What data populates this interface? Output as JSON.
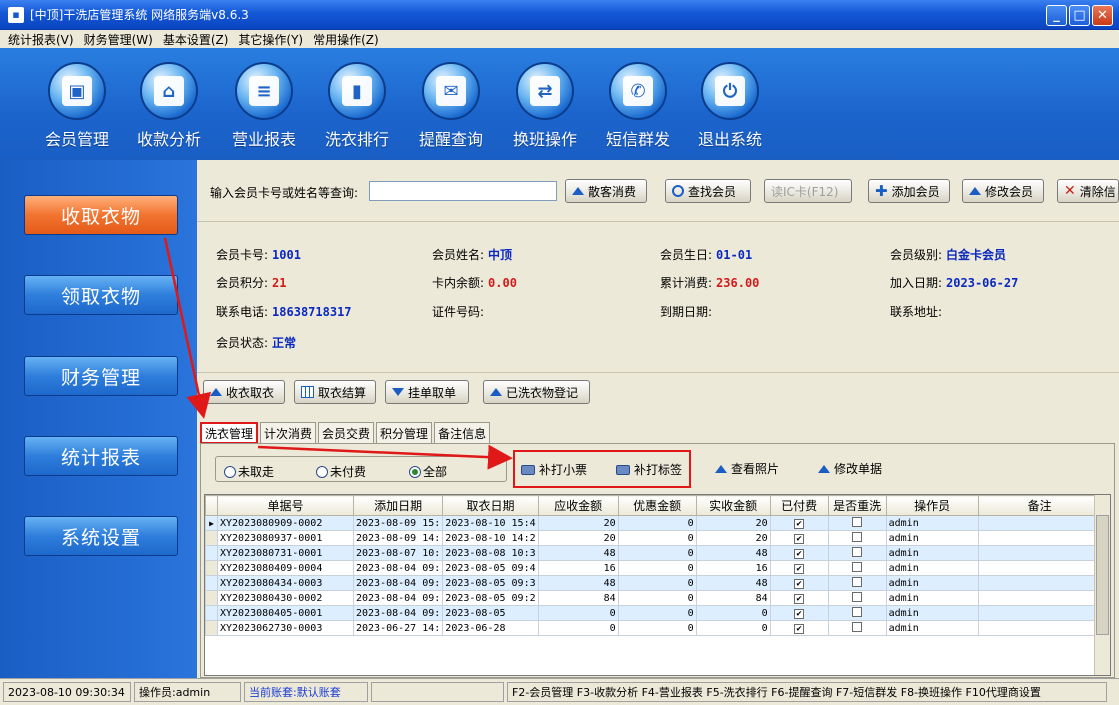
{
  "window": {
    "title": "[中顶]干洗店管理系统 网络服务端v8.6.3"
  },
  "menu": [
    "统计报表(V)",
    "财务管理(W)",
    "基本设置(Z)",
    "其它操作(Y)",
    "常用操作(Z)"
  ],
  "toolbar": [
    {
      "label": "会员管理",
      "icon": "member-card-icon",
      "glyph": "▣"
    },
    {
      "label": "收款分析",
      "icon": "home-icon",
      "glyph": "⌂"
    },
    {
      "label": "营业报表",
      "icon": "report-icon",
      "glyph": "≡"
    },
    {
      "label": "洗衣排行",
      "icon": "bar-chart-icon",
      "glyph": "▮"
    },
    {
      "label": "提醒查询",
      "icon": "message-icon",
      "glyph": "✉"
    },
    {
      "label": "换班操作",
      "icon": "swap-icon",
      "glyph": "⇄"
    },
    {
      "label": "短信群发",
      "icon": "sms-icon",
      "glyph": "✆"
    },
    {
      "label": "退出系统",
      "icon": "power-icon",
      "glyph": "⏻"
    }
  ],
  "sidebar": [
    {
      "label": "收取衣物",
      "active": true
    },
    {
      "label": "领取衣物",
      "active": false
    },
    {
      "label": "财务管理",
      "active": false
    },
    {
      "label": "统计报表",
      "active": false
    },
    {
      "label": "系统设置",
      "active": false
    }
  ],
  "search": {
    "label": "输入会员卡号或姓名等查询:",
    "value": "",
    "buttons": {
      "walkin": "散客消费",
      "find": "查找会员",
      "readcard": "读IC卡(F12)",
      "add": "添加会员",
      "edit": "修改会员",
      "clear": "清除信"
    }
  },
  "member": {
    "card_label": "会员卡号:",
    "card": "1001",
    "name_label": "会员姓名:",
    "name": "中顶",
    "birthday_label": "会员生日:",
    "birthday": "01-01",
    "level_label": "会员级别:",
    "level": "白金卡会员",
    "points_label": "会员积分:",
    "points": "21",
    "balance_label": "卡内余额:",
    "balance": "0.00",
    "total_label": "累计消费:",
    "total": "236.00",
    "joined_label": "加入日期:",
    "joined": "2023-06-27",
    "phone_label": "联系电话:",
    "phone": "18638718317",
    "id_label": "证件号码:",
    "expire_label": "到期日期:",
    "address_label": "联系地址:",
    "status_label": "会员状态:",
    "status": "正常"
  },
  "actions": {
    "receive": "收衣取衣",
    "settle": "取衣结算",
    "hold": "挂单取单",
    "register": "已洗衣物登记"
  },
  "tabs": [
    "洗衣管理",
    "计次消费",
    "会员交费",
    "积分管理",
    "备注信息"
  ],
  "filter": {
    "r1": "未取走",
    "r2": "未付费",
    "r3": "全部"
  },
  "tools": {
    "reprint_ticket": "补打小票",
    "reprint_label": "补打标签",
    "photos": "查看照片",
    "edit_order": "修改单据"
  },
  "table": {
    "headers": [
      "单据号",
      "添加日期",
      "取衣日期",
      "应收金额",
      "优惠金额",
      "实收金额",
      "已付费",
      "是否重洗",
      "操作员",
      "备注"
    ],
    "rows": [
      [
        "XY2023080909-0002",
        "2023-08-09 15:",
        "2023-08-10 15:4",
        "20",
        "0",
        "20",
        "✔",
        "",
        "admin",
        ""
      ],
      [
        "XY2023080937-0001",
        "2023-08-09 14:",
        "2023-08-10 14:2",
        "20",
        "0",
        "20",
        "✔",
        "",
        "admin",
        ""
      ],
      [
        "XY2023080731-0001",
        "2023-08-07 10:",
        "2023-08-08 10:3",
        "48",
        "0",
        "48",
        "✔",
        "",
        "admin",
        ""
      ],
      [
        "XY2023080409-0004",
        "2023-08-04 09:",
        "2023-08-05 09:4",
        "16",
        "0",
        "16",
        "✔",
        "",
        "admin",
        ""
      ],
      [
        "XY2023080434-0003",
        "2023-08-04 09:",
        "2023-08-05 09:3",
        "48",
        "0",
        "48",
        "✔",
        "",
        "admin",
        ""
      ],
      [
        "XY2023080430-0002",
        "2023-08-04 09:",
        "2023-08-05 09:2",
        "84",
        "0",
        "84",
        "✔",
        "",
        "admin",
        ""
      ],
      [
        "XY2023080405-0001",
        "2023-08-04 09:",
        "2023-08-05",
        "0",
        "0",
        "0",
        "✔",
        "",
        "admin",
        ""
      ],
      [
        "XY2023062730-0003",
        "2023-06-27 14:",
        "2023-06-28",
        "0",
        "0",
        "0",
        "✔",
        "",
        "admin",
        ""
      ]
    ]
  },
  "status": {
    "datetime": "2023-08-10 09:30:34",
    "operator": "操作员:admin",
    "account": "当前账套:默认账套",
    "shortcuts": "F2-会员管理 F3-收款分析 F4-营业报表 F5-洗衣排行 F6-提醒查询 F7-短信群发 F8-换班操作 F10代理商设置"
  },
  "colors": {
    "accent": "#1a5ec4",
    "active_side": "#f27430",
    "highlight": "#e01818"
  }
}
